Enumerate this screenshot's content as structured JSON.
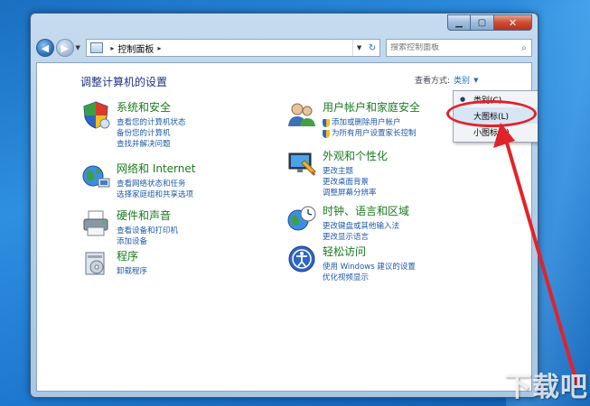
{
  "address": {
    "separator": "▸",
    "path": "控制面板",
    "trail": "▸"
  },
  "search": {
    "placeholder": "搜索控制面板"
  },
  "page": {
    "title": "调整计算机的设置"
  },
  "view_by": {
    "label": "查看方式:",
    "selected": "类别"
  },
  "view_menu": {
    "items": [
      {
        "label": "类别(C)",
        "selected": true
      },
      {
        "label": "大图标(L)",
        "selected": false
      },
      {
        "label": "小图标(S)",
        "selected": false
      }
    ]
  },
  "categories": [
    {
      "title": "系统和安全",
      "icon": "shield-icon",
      "links": [
        "查看您的计算机状态",
        "备份您的计算机",
        "查找并解决问题"
      ]
    },
    {
      "title": "网络和 Internet",
      "icon": "network-icon",
      "links": [
        "查看网络状态和任务",
        "选择家庭组和共享选项"
      ]
    },
    {
      "title": "硬件和声音",
      "icon": "printer-icon",
      "links": [
        "查看设备和打印机",
        "添加设备"
      ]
    },
    {
      "title": "程序",
      "icon": "programs-icon",
      "links": [
        "卸载程序"
      ]
    },
    {
      "title": "用户帐户和家庭安全",
      "icon": "users-icon",
      "links": [
        "添加或删除用户帐户",
        "为所有用户设置家长控制"
      ]
    },
    {
      "title": "外观和个性化",
      "icon": "appearance-icon",
      "links": [
        "更改主题",
        "更改桌面背景",
        "调整屏幕分辨率"
      ]
    },
    {
      "title": "时钟、语言和区域",
      "icon": "clock-globe-icon",
      "links": [
        "更改键盘或其他输入法",
        "更改显示语言"
      ]
    },
    {
      "title": "轻松访问",
      "icon": "ease-of-access-icon",
      "links": [
        "使用 Windows 建议的设置",
        "优化视频显示"
      ]
    }
  ],
  "colors": {
    "title_blue": "#1e3287",
    "category_green": "#1b7a1f",
    "link_blue": "#1c5aa8",
    "annotation_red": "#e2222a"
  },
  "watermark": {
    "text": "下载吧"
  }
}
